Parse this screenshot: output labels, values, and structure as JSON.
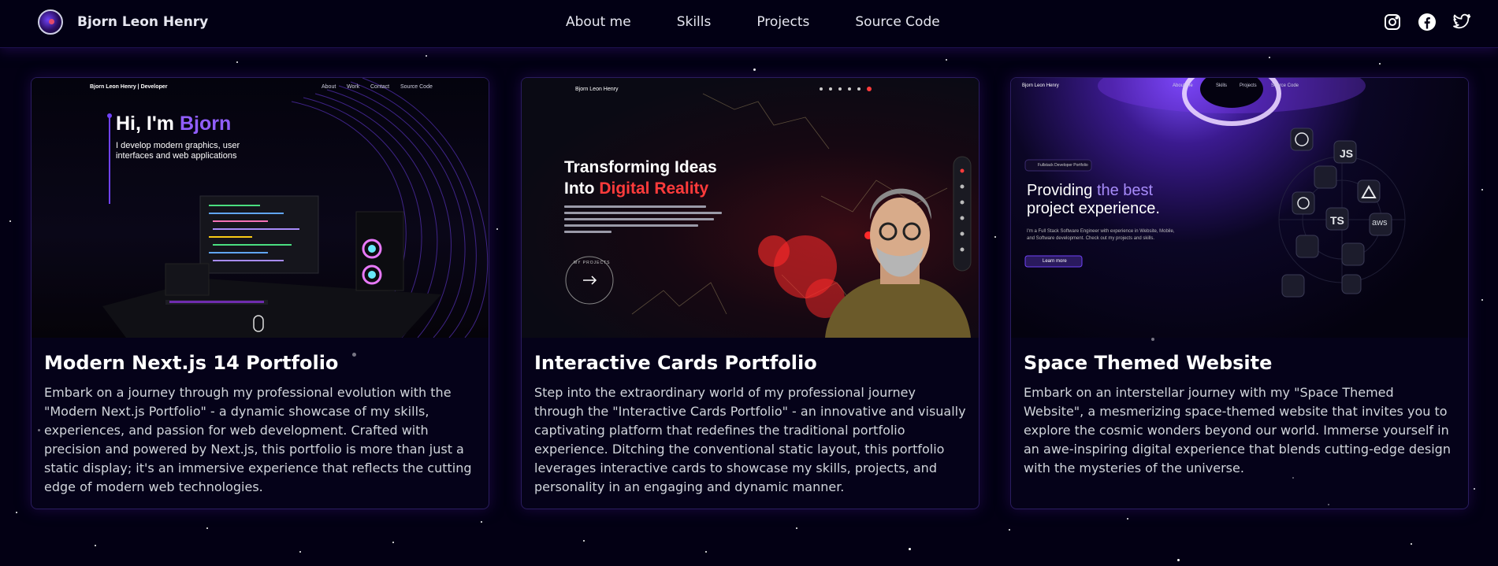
{
  "navbar": {
    "brand": "Bjorn Leon Henry",
    "links": [
      "About me",
      "Skills",
      "Projects",
      "Source Code"
    ],
    "social_icons": [
      "instagram-icon",
      "facebook-icon",
      "twitter-icon"
    ]
  },
  "projects": [
    {
      "title": "Modern Next.js 14 Portfolio",
      "description": "Embark on a journey through my professional evolution with the \"Modern Next.js Portfolio\" - a dynamic showcase of my skills, experiences, and passion for web development. Crafted with precision and powered by Next.js, this portfolio is more than just a static display; it's an immersive experience that reflects the cutting edge of modern web technologies.",
      "preview": {
        "brand": "Bjorn Leon Henry | Developer",
        "nav": [
          "About",
          "Work",
          "Contact",
          "Source Code"
        ],
        "heading_prefix": "Hi, I'm ",
        "heading_name": "Bjorn",
        "subtitle_line1": "I develop modern graphics, user",
        "subtitle_line2": "interfaces and web applications"
      }
    },
    {
      "title": "Interactive Cards Portfolio",
      "description": "Step into the extraordinary world of my professional journey through the \"Interactive Cards Portfolio\" - an innovative and visually captivating platform that redefines the traditional portfolio experience. Ditching the conventional static layout, this portfolio leverages interactive cards to showcase my skills, projects, and personality in an engaging and dynamic manner.",
      "preview": {
        "brand": "Bjorn Leon Henry",
        "heading_line1": "Transforming Ideas",
        "heading_line2_prefix": "Into ",
        "heading_line2_accent": "Digital Reality",
        "badge": "MY PROJECTS"
      }
    },
    {
      "title": "Space Themed Website",
      "description": "Embark on an interstellar journey with my \"Space Themed Website\", a mesmerizing space-themed website that invites you to explore the cosmic wonders beyond our world. Immerse yourself in an awe-inspiring digital experience that blends cutting-edge design with the mysteries of the universe.",
      "preview": {
        "brand": "Bjorn Leon Henry",
        "nav": [
          "About me",
          "Skills",
          "Projects",
          "Source Code"
        ],
        "tag": "Fullstack Developer Portfolio",
        "heading_line1_prefix": "Providing ",
        "heading_line1_accent": "the best",
        "heading_line2": "project experience.",
        "paragraph_line1": "I'm a Full Stack Software Engineer with experience in Website, Mobile,",
        "paragraph_line2": "and Software development. Check out my projects and skills.",
        "button": "Learn more",
        "skill_labels": [
          "JS",
          "TS",
          "aws"
        ]
      }
    }
  ],
  "colors": {
    "background": "#030014",
    "accent_purple": "#7042f8",
    "card_border": "#2a1d5e",
    "accent_red": "#ff3b3b",
    "accent_cyan": "#22d3ee"
  }
}
